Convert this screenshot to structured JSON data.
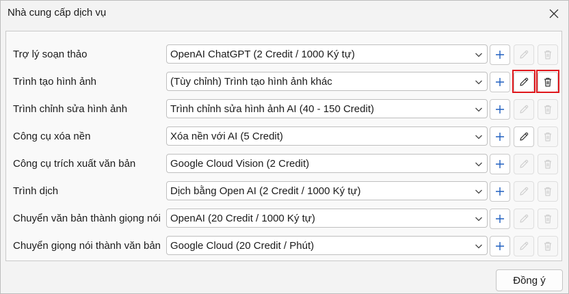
{
  "window": {
    "title": "Nhà cung cấp dịch vụ"
  },
  "rows": [
    {
      "label": "Trợ lý soạn thảo",
      "value": "OpenAI ChatGPT (2 Credit / 1000 Ký tự)",
      "edit_enabled": false,
      "delete_enabled": false
    },
    {
      "label": "Trình tạo hình ảnh",
      "value": "(Tùy chỉnh) Trình tạo hình ảnh khác",
      "edit_enabled": true,
      "delete_enabled": true
    },
    {
      "label": "Trình chỉnh sửa hình ảnh",
      "value": "Trình chỉnh sửa hình ảnh AI (40 - 150 Credit)",
      "edit_enabled": false,
      "delete_enabled": false
    },
    {
      "label": "Công cụ xóa nền",
      "value": "Xóa nền với AI (5 Credit)",
      "edit_enabled": true,
      "delete_enabled": false
    },
    {
      "label": "Công cụ trích xuất văn bản",
      "value": "Google Cloud Vision (2 Credit)",
      "edit_enabled": false,
      "delete_enabled": false
    },
    {
      "label": "Trình dịch",
      "value": "Dịch bằng Open AI (2 Credit / 1000 Ký tự)",
      "edit_enabled": false,
      "delete_enabled": false
    },
    {
      "label": "Chuyển văn bản thành giọng nói",
      "value": "OpenAI (20 Credit / 1000 Ký tự)",
      "edit_enabled": false,
      "delete_enabled": false
    },
    {
      "label": "Chuyển giọng nói thành văn bản",
      "value": "Google Cloud (20 Credit / Phút)",
      "edit_enabled": false,
      "delete_enabled": false
    }
  ],
  "footer": {
    "ok_label": "Đồng ý"
  },
  "icons": {
    "add": "plus-icon",
    "edit": "pencil-icon",
    "delete": "trash-icon",
    "close": "close-icon",
    "dropdown": "chevron-down-icon"
  },
  "colors": {
    "accent": "#1f5fbf",
    "highlight": "#e0161b",
    "disabled_icon": "#cfcfcf"
  }
}
